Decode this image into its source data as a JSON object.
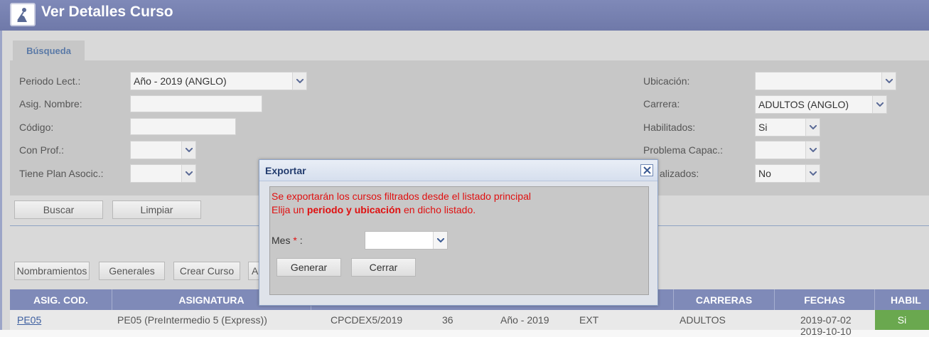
{
  "window": {
    "title": "Ver Detalles Curso"
  },
  "search_tab": {
    "label": "Búsqueda"
  },
  "filters": {
    "periodo_label": "Periodo Lect.:",
    "periodo_value": "Año - 2019 (ANGLO)",
    "asig_nombre_label": "Asig. Nombre:",
    "codigo_label": "Código:",
    "con_prof_label": "Con Prof.:",
    "plan_label": "Tiene Plan Asocic.:",
    "ubicacion_label": "Ubicación:",
    "carrera_label": "Carrera:",
    "carrera_value": "ADULTOS (ANGLO)",
    "habilitados_label": "Habilitados:",
    "habilitados_value": "Si",
    "problema_label": "Problema Capac.:",
    "finalizados_label": "alizados:",
    "finalizados_value": "No"
  },
  "actions": {
    "buscar": "Buscar",
    "limpiar": "Limpiar"
  },
  "toolbar": {
    "nombramientos": "Nombramientos",
    "generales": "Generales",
    "crear_curso": "Crear Curso",
    "partial": "A"
  },
  "table": {
    "headers": {
      "asig_cod": "ASIG. COD.",
      "asignatura": "ASIGNATURA",
      "carreras": "CARRERAS",
      "fechas": "FECHAS",
      "habil": "HABIL"
    },
    "row": {
      "code": "PE05",
      "name": "PE05 (PreIntermedio 5 (Express))",
      "curso": "CPCDEX5/2019",
      "num": "36",
      "periodo": "Año - 2019",
      "tipo": "EXT",
      "carrera": "ADULTOS",
      "fecha1": "2019-07-02",
      "fecha2": "2019-10-10",
      "habil": "Si"
    }
  },
  "modal": {
    "title": "Exportar",
    "line1": "Se exportarán los cursos filtrados desde el listado principal",
    "line2_pre": "Elija un ",
    "line2_bold": "periodo y ubicación",
    "line2_post": " en dicho listado.",
    "mes_label": "Mes",
    "required_mark": "*",
    "colon": ":",
    "generar": "Generar",
    "cerrar": "Cerrar"
  },
  "colors": {
    "header": "#7f8ab8",
    "accent_green": "#6aa84f",
    "error_red": "#e01010"
  }
}
